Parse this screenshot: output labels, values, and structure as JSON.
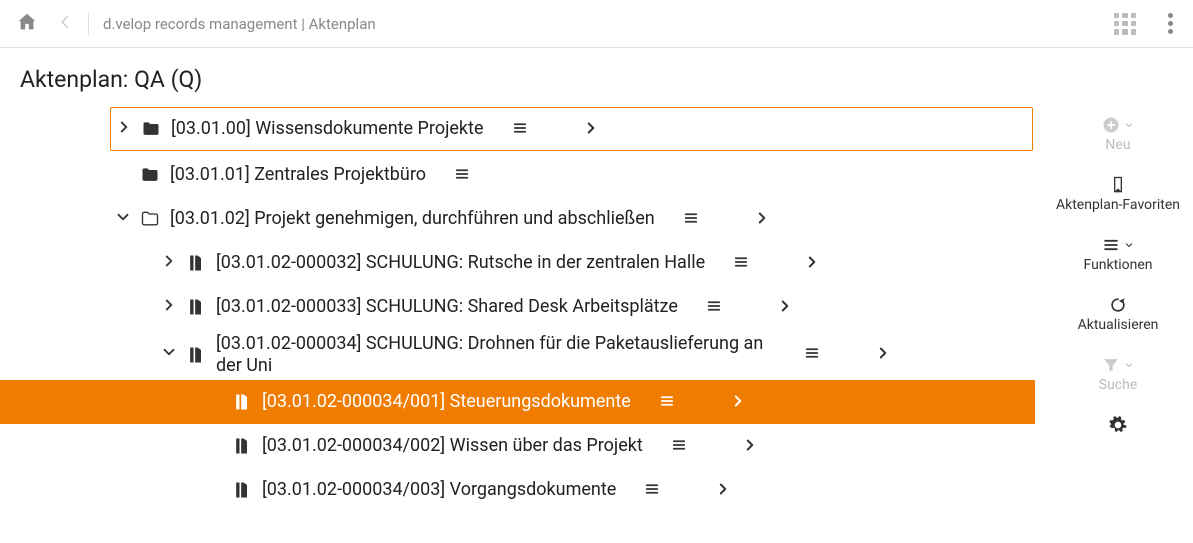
{
  "header": {
    "app_title": "d.velop records management | Aktenplan"
  },
  "page_title": "Aktenplan: QA (Q)",
  "tree": [
    {
      "id": "n0",
      "indent": 0,
      "toggle": "right",
      "icon": "folder-filled",
      "label": "[03.01.00] Wissensdokumente Projekte",
      "menu": true,
      "nav": true,
      "selected": true,
      "active": false
    },
    {
      "id": "n1",
      "indent": 0,
      "toggle": "none",
      "icon": "folder-filled",
      "label": "[03.01.01] Zentrales Projektbüro",
      "menu": true,
      "nav": false,
      "selected": false,
      "active": false
    },
    {
      "id": "n2",
      "indent": 0,
      "toggle": "down",
      "icon": "folder-outline",
      "label": "[03.01.02] Projekt genehmigen, durchführen und abschließen",
      "menu": true,
      "nav": true,
      "selected": false,
      "active": false
    },
    {
      "id": "n3",
      "indent": 1,
      "toggle": "right",
      "icon": "binder",
      "label": "[03.01.02-000032] SCHULUNG: Rutsche in der zentralen Halle",
      "menu": true,
      "nav": true,
      "selected": false,
      "active": false
    },
    {
      "id": "n4",
      "indent": 1,
      "toggle": "right",
      "icon": "binder",
      "label": "[03.01.02-000033] SCHULUNG: Shared Desk Arbeitsplätze",
      "menu": true,
      "nav": true,
      "selected": false,
      "active": false
    },
    {
      "id": "n5",
      "indent": 1,
      "toggle": "down",
      "icon": "binder",
      "label": "[03.01.02-000034] SCHULUNG: Drohnen für die Paketauslieferung an der Uni",
      "menu": true,
      "nav": true,
      "selected": false,
      "active": false
    },
    {
      "id": "n6",
      "indent": 2,
      "toggle": "none",
      "icon": "binder",
      "label": "[03.01.02-000034/001] Steuerungsdokumente",
      "menu": true,
      "nav": true,
      "selected": false,
      "active": true
    },
    {
      "id": "n7",
      "indent": 2,
      "toggle": "none",
      "icon": "binder",
      "label": "[03.01.02-000034/002] Wissen über das Projekt",
      "menu": true,
      "nav": true,
      "selected": false,
      "active": false
    },
    {
      "id": "n8",
      "indent": 2,
      "toggle": "none",
      "icon": "binder",
      "label": "[03.01.02-000034/003] Vorgangsdokumente",
      "menu": true,
      "nav": true,
      "selected": false,
      "active": false
    }
  ],
  "rail": {
    "new": "Neu",
    "favorites": "Aktenplan-Favoriten",
    "functions": "Funktionen",
    "refresh": "Aktualisieren",
    "search": "Suche"
  }
}
